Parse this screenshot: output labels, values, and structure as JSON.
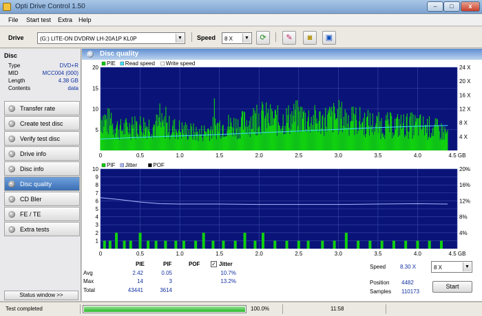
{
  "window": {
    "title": "Opti Drive Control 1.50",
    "min_label": "–",
    "max_label": "□",
    "close_label": "x"
  },
  "menu": [
    "File",
    "Start test",
    "Extra",
    "Help"
  ],
  "toolbar": {
    "drive_label": "Drive",
    "drive_value": "(G:)  LITE-ON DVDRW LH-20A1P KL0P",
    "speed_label": "Speed",
    "speed_value": "8 X"
  },
  "disc": {
    "heading": "Disc",
    "rows": [
      {
        "k": "Type",
        "v": "DVD+R"
      },
      {
        "k": "MID",
        "v": "MCC004 (000)"
      },
      {
        "k": "Length",
        "v": "4.38 GB"
      },
      {
        "k": "Contents",
        "v": "data"
      }
    ]
  },
  "nav": [
    {
      "label": "Transfer rate",
      "active": false
    },
    {
      "label": "Create test disc",
      "active": false
    },
    {
      "label": "Verify test disc",
      "active": false
    },
    {
      "label": "Drive info",
      "active": false
    },
    {
      "label": "Disc info",
      "active": false
    },
    {
      "label": "Disc quality",
      "active": true
    },
    {
      "label": "CD Bler",
      "active": false
    },
    {
      "label": "FE / TE",
      "active": false
    },
    {
      "label": "Extra tests",
      "active": false
    }
  ],
  "status_window_label": "Status window >>",
  "main": {
    "title": "Disc quality"
  },
  "chart_data": [
    {
      "type": "area",
      "legend": [
        "PIE",
        "Read speed",
        "Write speed"
      ],
      "legend_colors": [
        "#00cc00",
        "#40e0ff",
        "#ffffff"
      ],
      "x_ticks": [
        "0",
        "0.5",
        "1.0",
        "1.5",
        "2.0",
        "2.5",
        "3.0",
        "3.5",
        "4.0",
        "4.5 GB"
      ],
      "xlim": [
        0,
        4.5
      ],
      "y_ticks_left": [
        "5",
        "10",
        "15",
        "20"
      ],
      "ylim_left": [
        0,
        20
      ],
      "y_ticks_right": [
        "4 X",
        "8 X",
        "12 X",
        "16 X",
        "20 X",
        "24 X"
      ],
      "ylim_right": [
        0,
        24
      ],
      "series": [
        {
          "name": "PIE",
          "x": [
            0,
            0.25,
            0.5,
            0.75,
            1.0,
            1.25,
            1.5,
            1.75,
            2.0,
            2.25,
            2.5,
            2.75,
            3.0,
            3.25,
            3.5,
            3.75,
            4.0,
            4.25,
            4.38
          ],
          "values": [
            8,
            5,
            6,
            6,
            5,
            4,
            6,
            6,
            8,
            7,
            8,
            7,
            8,
            7,
            6,
            6,
            6,
            5,
            4
          ]
        },
        {
          "name": "Read speed",
          "x": [
            0,
            0.5,
            1.0,
            1.5,
            2.0,
            2.5,
            3.0,
            3.5,
            4.0,
            4.38
          ],
          "values": [
            3.3,
            3.8,
            4.2,
            4.6,
            5.1,
            5.6,
            6.1,
            6.6,
            7.0,
            7.2
          ]
        }
      ]
    },
    {
      "type": "bar",
      "legend": [
        "PIF",
        "Jitter",
        "POF"
      ],
      "legend_colors": [
        "#00cc00",
        "#aab8ff",
        "#000000"
      ],
      "x_ticks": [
        "0",
        "0.5",
        "1.0",
        "1.5",
        "2.0",
        "2.5",
        "3.0",
        "3.5",
        "4.0",
        "4.5 GB"
      ],
      "xlim": [
        0,
        4.5
      ],
      "y_ticks_left": [
        "1",
        "2",
        "3",
        "4",
        "5",
        "6",
        "7",
        "8",
        "9",
        "10"
      ],
      "ylim_left": [
        0,
        10
      ],
      "y_ticks_right": [
        "4%",
        "8%",
        "12%",
        "16%",
        "20%"
      ],
      "ylim_right": [
        0,
        20
      ],
      "series": [
        {
          "name": "PIF",
          "x": [
            0.05,
            0.12,
            0.2,
            0.3,
            0.38,
            0.5,
            0.6,
            0.7,
            0.82,
            0.95,
            1.05,
            1.2,
            1.3,
            1.42,
            1.55,
            1.7,
            1.82,
            1.95,
            2.05,
            2.2,
            2.35,
            2.5,
            2.62,
            2.8,
            2.95,
            3.1,
            3.25,
            3.4,
            3.55,
            3.7,
            3.85,
            4.0,
            4.15,
            4.3
          ],
          "values": [
            1,
            1,
            2,
            1,
            1,
            2,
            1,
            1,
            1,
            1,
            1,
            1,
            2,
            1,
            1,
            1,
            2,
            1,
            2,
            1,
            1,
            1,
            1,
            1,
            1,
            2,
            1,
            1,
            1,
            1,
            1,
            1,
            1,
            1
          ]
        },
        {
          "name": "Jitter",
          "x": [
            0,
            0.25,
            0.5,
            0.75,
            1.0,
            1.5,
            2.0,
            2.5,
            3.0,
            3.5,
            4.0,
            4.38
          ],
          "values": [
            12.8,
            12.3,
            11.7,
            11.3,
            11.2,
            11.2,
            11.1,
            11.1,
            11.1,
            11.2,
            11.3,
            11.2
          ]
        }
      ]
    }
  ],
  "stats": {
    "headers": [
      "PIE",
      "PIF",
      "POF",
      "Jitter"
    ],
    "rows": [
      {
        "label": "Avg",
        "pie": "2.42",
        "pif": "0.05",
        "pof": "",
        "jitter": "10.7%"
      },
      {
        "label": "Max",
        "pie": "14",
        "pif": "3",
        "pof": "",
        "jitter": "13.2%"
      },
      {
        "label": "Total",
        "pie": "43441",
        "pif": "3614",
        "pof": "",
        "jitter": ""
      }
    ],
    "jitter_checked": true,
    "check_mark": "✓",
    "speed_label": "Speed",
    "speed_value": "8.30 X",
    "speed_combo": "8 X",
    "position_label": "Position",
    "position_value": "4482",
    "samples_label": "Samples",
    "samples_value": "110173",
    "start_label": "Start"
  },
  "statusbar": {
    "status": "Test completed",
    "progress_percent": 100,
    "progress_text": "100.0%",
    "time": "11:58"
  }
}
